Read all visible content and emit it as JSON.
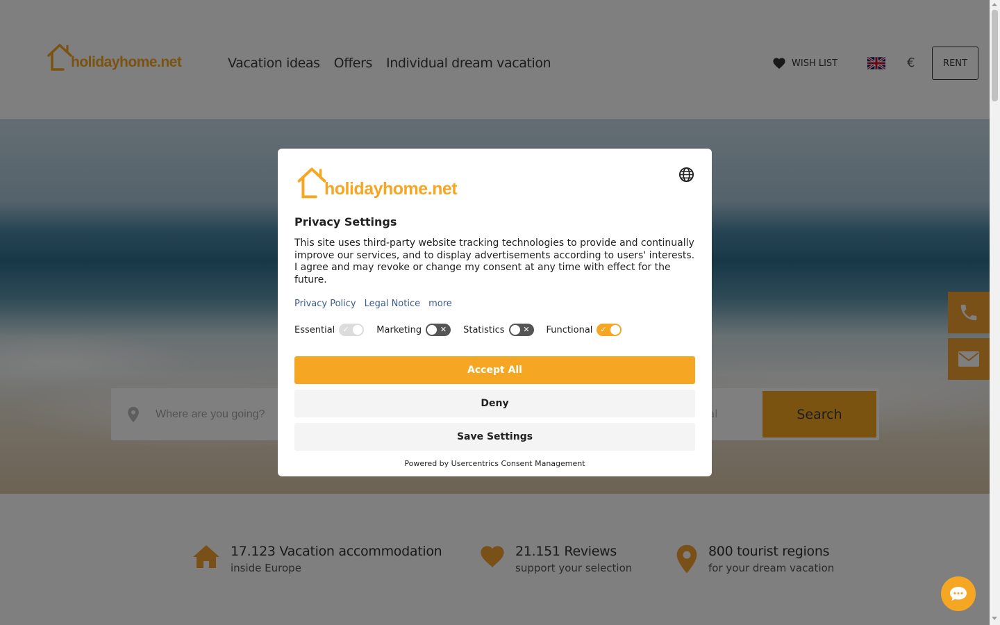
{
  "header": {
    "logo_text": "holidayhome.net",
    "nav": [
      "Vacation ideas",
      "Offers",
      "Individual dream vacation"
    ],
    "wishlist_label": "WISH LIST",
    "currency": "€",
    "rent_label": "RENT"
  },
  "search": {
    "placeholder": "Where are you going?",
    "partial_field_text": "al",
    "button_label": "Search"
  },
  "stats": [
    {
      "title": "17.123 Vacation accommodation",
      "subtitle": "inside Europe",
      "icon": "house-icon"
    },
    {
      "title": "21.151 Reviews",
      "subtitle": "support your selection",
      "icon": "heart-icon"
    },
    {
      "title": "800 tourist regions",
      "subtitle": "for your dream vacation",
      "icon": "map-pin-icon"
    }
  ],
  "modal": {
    "logo_text": "holidayhome.net",
    "title": "Privacy Settings",
    "body": "This site uses third-party website tracking technologies to provide and continually improve our services, and to display advertisements according to users' interests. I agree and may revoke or change my consent at any time with effect for the future.",
    "links": [
      "Privacy Policy",
      "Legal Notice",
      "more"
    ],
    "toggles": [
      {
        "label": "Essential",
        "state": "on-disabled"
      },
      {
        "label": "Marketing",
        "state": "off"
      },
      {
        "label": "Statistics",
        "state": "off"
      },
      {
        "label": "Functional",
        "state": "on"
      }
    ],
    "accept_label": "Accept All",
    "deny_label": "Deny",
    "save_label": "Save Settings",
    "powered_by": "Powered by Usercentrics Consent Management"
  },
  "colors": {
    "accent": "#f5a623",
    "overlay": "rgba(0,0,0,0.5)"
  }
}
